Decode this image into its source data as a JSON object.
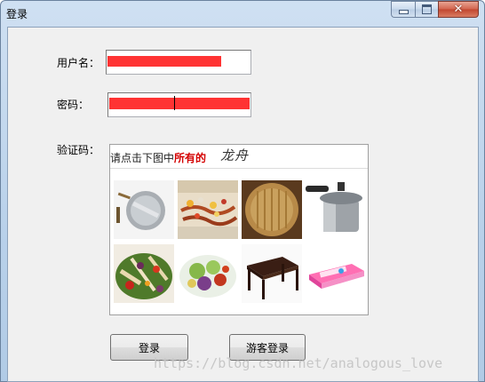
{
  "window": {
    "title": "登录"
  },
  "form": {
    "username_label": "用户名：",
    "password_label": "密码：",
    "captcha_label": "验证码："
  },
  "captcha": {
    "prompt_prefix": "请点击下图中",
    "prompt_emphasis": "所有的",
    "target_word": "龙舟",
    "tiles": [
      "pan-image",
      "dragon-boat-race-image",
      "bamboo-steamer-image",
      "pressure-cooker-image",
      "salad-image",
      "salad-bowl-image",
      "table-image",
      "toy-box-image"
    ]
  },
  "buttons": {
    "login": "登录",
    "guest_login": "游客登录"
  },
  "watermark": "https://blog.csdn.net/analogous_love",
  "colors": {
    "redaction": "#ff3333",
    "emphasis": "#d40000",
    "close_button": "#c1462f"
  }
}
